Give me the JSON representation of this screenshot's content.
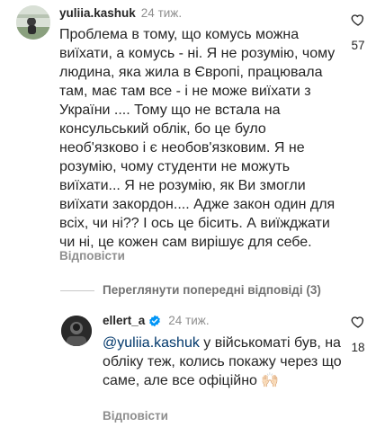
{
  "comment1": {
    "username": "yuliia.kashuk",
    "time": "24 тиж.",
    "text": "Проблема в тому, що комусь можна виїхати, а комусь - ні. Я не розумію, чому людина, яка жила в Європі, працювала там, має там все - і не може виїхати з України .... Тому що не встала на консульський облік, бо це було необ'язково і є необов'язковим. Я не розумію, чому студенти не можуть виїхати... Я не розумію, як Ви змогли виїхати закордон.... Адже закон один для всіх, чи ні?? І ось це бісить. А виїжджати чи ні, це кожен сам вирішує для себе.",
    "likes": "57",
    "reply_label": "Відповісти",
    "like_icon": "heart-outline-icon"
  },
  "view_previous": "Переглянути попередні відповіді (3)",
  "comment2": {
    "username": "ellert_a",
    "verified_icon": "verified-badge-icon",
    "time": "24 тиж.",
    "mention": "@yuliia.kashuk",
    "text": " у військоматі був, на обліку теж, колись покажу через що саме, але все офіційно ",
    "emoji": "🙌🏻",
    "likes": "18",
    "reply_label": "Відповісти",
    "like_icon": "heart-outline-icon"
  },
  "colors": {
    "text": "#262626",
    "muted": "#8e8e8e",
    "mention": "#00376b",
    "verified": "#0095f6"
  }
}
